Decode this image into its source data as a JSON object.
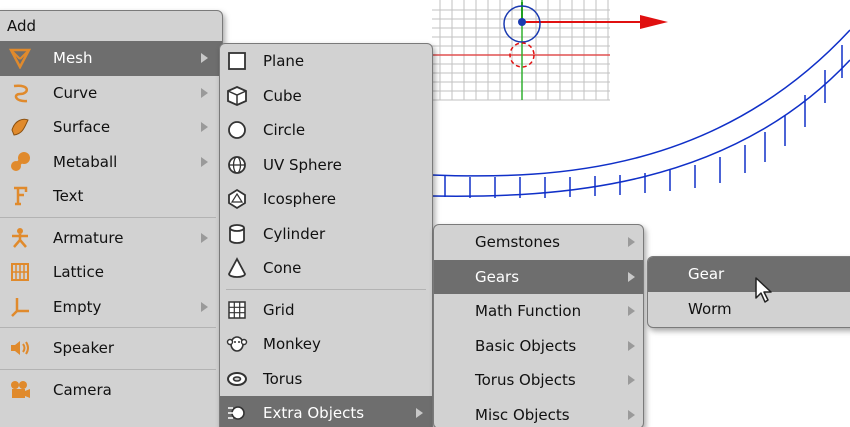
{
  "add_menu": {
    "title": "Add",
    "items": [
      {
        "label": "Mesh",
        "icon": "mesh-icon",
        "submenu": true,
        "selected": true
      },
      {
        "label": "Curve",
        "icon": "curve-icon",
        "submenu": true
      },
      {
        "label": "Surface",
        "icon": "surface-icon",
        "submenu": true
      },
      {
        "label": "Metaball",
        "icon": "metaball-icon",
        "submenu": true
      },
      {
        "label": "Text",
        "icon": "text-icon",
        "submenu": false
      },
      {
        "label": "Armature",
        "icon": "armature-icon",
        "submenu": true
      },
      {
        "label": "Lattice",
        "icon": "lattice-icon",
        "submenu": false
      },
      {
        "label": "Empty",
        "icon": "empty-icon",
        "submenu": true
      },
      {
        "label": "Speaker",
        "icon": "speaker-icon",
        "submenu": false
      },
      {
        "label": "Camera",
        "icon": "camera-icon",
        "submenu": false
      }
    ]
  },
  "mesh_menu": {
    "items": [
      {
        "label": "Plane",
        "icon": "plane-icon"
      },
      {
        "label": "Cube",
        "icon": "cube-icon"
      },
      {
        "label": "Circle",
        "icon": "circle-icon"
      },
      {
        "label": "UV Sphere",
        "icon": "uv-sphere-icon"
      },
      {
        "label": "Icosphere",
        "icon": "icosphere-icon"
      },
      {
        "label": "Cylinder",
        "icon": "cylinder-icon"
      },
      {
        "label": "Cone",
        "icon": "cone-icon"
      },
      {
        "label": "Grid",
        "icon": "grid-icon"
      },
      {
        "label": "Monkey",
        "icon": "monkey-icon"
      },
      {
        "label": "Torus",
        "icon": "torus-icon"
      },
      {
        "label": "Extra Objects",
        "icon": "extra-objects-icon",
        "selected": true
      }
    ]
  },
  "extra_menu": {
    "items": [
      {
        "label": "Gemstones"
      },
      {
        "label": "Gears",
        "selected": true
      },
      {
        "label": "Math Function"
      },
      {
        "label": "Basic Objects"
      },
      {
        "label": "Torus Objects"
      },
      {
        "label": "Misc Objects"
      }
    ]
  },
  "gears_menu": {
    "items": [
      {
        "label": "Gear",
        "selected": true
      },
      {
        "label": "Worm"
      }
    ]
  },
  "colors": {
    "menu_bg": "#d2d2d2",
    "selected_bg": "#6e6e6e",
    "icon_orange": "#e08a2c",
    "viewport_grid": "#b8b8b8",
    "axis_red": "#e01010",
    "mesh_blue": "#1030c8"
  }
}
